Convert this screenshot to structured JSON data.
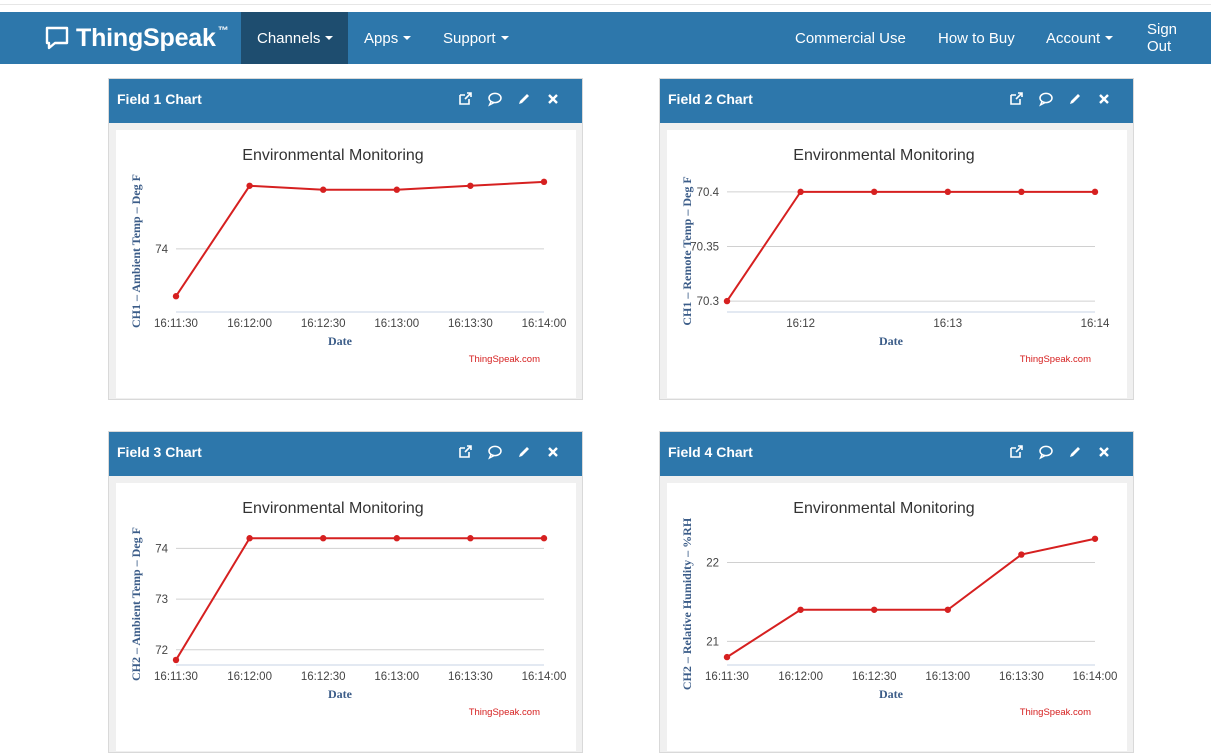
{
  "nav": {
    "brand": "ThingSpeak",
    "trademark": "™",
    "items": [
      "Channels",
      "Apps",
      "Support"
    ],
    "right_items": [
      "Commercial Use",
      "How to Buy",
      "Account",
      "Sign Out"
    ],
    "active_item": "Channels"
  },
  "panel_icons": [
    "external-link-icon",
    "comment-icon",
    "pencil-icon",
    "close-icon"
  ],
  "colors": {
    "navbar": "#2d77ab",
    "active": "#1e4d6f",
    "series": "#d62020"
  },
  "panels": [
    {
      "title": "Field 1 Chart",
      "credit": "ThingSpeak.com"
    },
    {
      "title": "Field 2 Chart",
      "credit": "ThingSpeak.com"
    },
    {
      "title": "Field 3 Chart",
      "credit": "ThingSpeak.com"
    },
    {
      "title": "Field 4 Chart",
      "credit": "ThingSpeak.com"
    }
  ],
  "chart_data": [
    {
      "type": "line",
      "title": "Environmental Monitoring",
      "xlabel": "Date",
      "ylabel": "CH1 – Ambient Temp – Deg F",
      "x": [
        "16:11:30",
        "16:12:00",
        "16:12:30",
        "16:13:00",
        "16:13:30",
        "16:14:00"
      ],
      "x_ticks": [
        "16:11:30",
        "16:12:00",
        "16:12:30",
        "16:13:00",
        "16:13:30",
        "16:14:00"
      ],
      "y_ticks": [
        74
      ],
      "ylim": [
        73.84,
        74.2
      ],
      "series": [
        {
          "values": [
            73.88,
            74.16,
            74.15,
            74.15,
            74.16,
            74.17
          ]
        }
      ]
    },
    {
      "type": "line",
      "title": "Environmental Monitoring",
      "xlabel": "Date",
      "ylabel": "CH1 – Remote Temp – Deg F",
      "x": [
        "16:11:30",
        "16:12:00",
        "16:12:30",
        "16:13:00",
        "16:13:30",
        "16:14:00"
      ],
      "x_ticks": [
        "16:12",
        "16:13",
        "16:14"
      ],
      "y_ticks": [
        70.3,
        70.35,
        70.4
      ],
      "ylim": [
        70.29,
        70.42
      ],
      "series": [
        {
          "values": [
            70.3,
            70.4,
            70.4,
            70.4,
            70.4,
            70.4
          ]
        }
      ]
    },
    {
      "type": "line",
      "title": "Environmental Monitoring",
      "xlabel": "Date",
      "ylabel": "CH2 – Ambient Temp – Deg F",
      "x": [
        "16:11:30",
        "16:12:00",
        "16:12:30",
        "16:13:00",
        "16:13:30",
        "16:14:00"
      ],
      "x_ticks": [
        "16:11:30",
        "16:12:00",
        "16:12:30",
        "16:13:00",
        "16:13:30",
        "16:14:00"
      ],
      "y_ticks": [
        72,
        73,
        74
      ],
      "ylim": [
        71.7,
        74.5
      ],
      "series": [
        {
          "values": [
            71.8,
            74.2,
            74.2,
            74.2,
            74.2,
            74.2
          ]
        }
      ]
    },
    {
      "type": "line",
      "title": "Environmental Monitoring",
      "xlabel": "Date",
      "ylabel": "CH2 – Relative Humidity – %RH",
      "x": [
        "16:11:30",
        "16:12:00",
        "16:12:30",
        "16:13:00",
        "16:13:30",
        "16:14:00"
      ],
      "x_ticks": [
        "16:11:30",
        "16:12:00",
        "16:12:30",
        "16:13:00",
        "16:13:30",
        "16:14:00"
      ],
      "y_ticks": [
        21,
        22
      ],
      "ylim": [
        20.7,
        22.5
      ],
      "series": [
        {
          "values": [
            20.8,
            21.4,
            21.4,
            21.4,
            22.1,
            22.3
          ]
        }
      ]
    }
  ]
}
